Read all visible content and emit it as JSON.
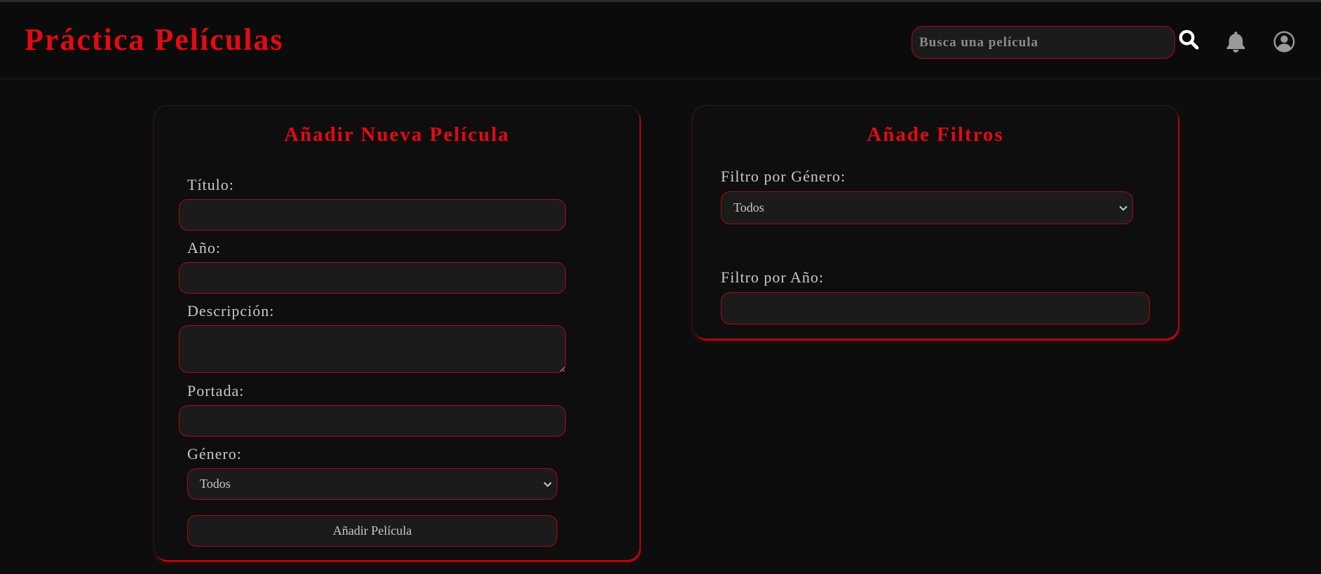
{
  "header": {
    "brand": "Práctica Películas",
    "search_placeholder": "Busca una película"
  },
  "add_form": {
    "title": "Añadir Nueva Película",
    "titulo_label": "Título:",
    "titulo_value": "",
    "anio_label": "Año:",
    "anio_value": "",
    "descripcion_label": "Descripción:",
    "descripcion_value": "",
    "portada_label": "Portada:",
    "portada_value": "",
    "genero_label": "Género:",
    "genero_selected": "Todos",
    "submit_label": "Añadir Película"
  },
  "filters": {
    "title": "Añade Filtros",
    "genero_label": "Filtro por Género:",
    "genero_selected": "Todos",
    "anio_label": "Filtro por Año:",
    "anio_value": ""
  },
  "colors": {
    "accent": "#e50914",
    "border": "#b00710",
    "background": "#0d0d0d",
    "field_bg": "#1b1b1b",
    "text": "#c9c9c9"
  },
  "icons": {
    "search": "search-icon",
    "notifications": "bell-icon",
    "profile": "user-circle-icon",
    "dropdown": "chevron-down-icon"
  }
}
